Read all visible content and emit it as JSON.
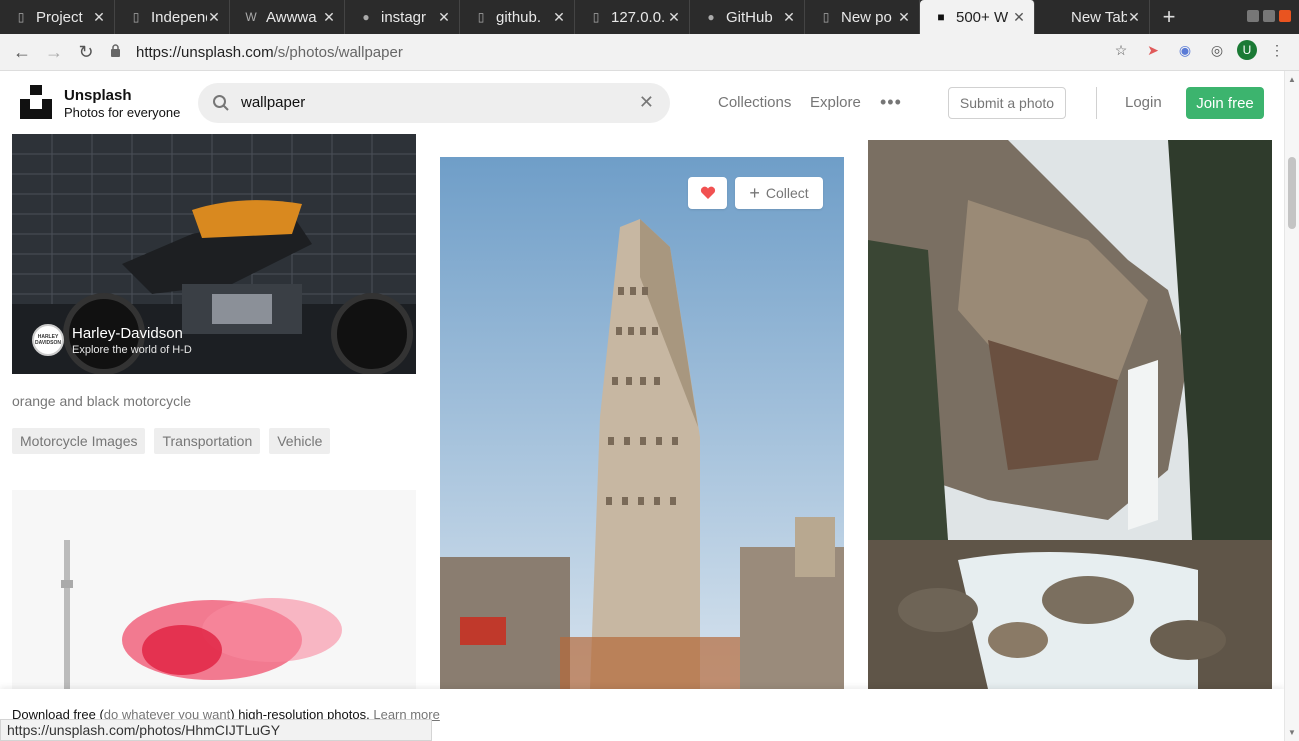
{
  "browser": {
    "tabs": [
      {
        "title": "Project",
        "icon": "page-icon"
      },
      {
        "title": "Independ",
        "icon": "page-icon"
      },
      {
        "title": "Awwwa",
        "icon": "awwwards-icon"
      },
      {
        "title": "instagr",
        "icon": "github-icon"
      },
      {
        "title": "github.",
        "icon": "page-icon"
      },
      {
        "title": "127.0.0.",
        "icon": "page-icon"
      },
      {
        "title": "GitHub",
        "icon": "github-icon"
      },
      {
        "title": "New po",
        "icon": "page-icon"
      },
      {
        "title": "500+ W",
        "icon": "unsplash-icon",
        "active": true
      },
      {
        "title": "New Tab",
        "icon": "none"
      }
    ],
    "url_host": "https://unsplash.com",
    "url_path": "/s/photos/wallpaper",
    "profile_initial": "U",
    "status_url": "https://unsplash.com/photos/HhmCIJTLuGY"
  },
  "header": {
    "brand_name": "Unsplash",
    "brand_tagline": "Photos for everyone",
    "search_value": "wallpaper",
    "nav": {
      "collections": "Collections",
      "explore": "Explore",
      "more": "•••"
    },
    "submit_label": "Submit a photo",
    "login_label": "Login",
    "join_label": "Join free",
    "accent_color": "#3cb46e"
  },
  "photos": {
    "sponsor_name": "Harley-Davidson",
    "sponsor_subtitle": "Explore the world of H-D",
    "sponsor_avatar_text": "HARLEY DAVIDSON",
    "caption": "orange and black motorcycle",
    "tags": [
      "Motorcycle Images",
      "Transportation",
      "Vehicle"
    ],
    "collect_label": "Collect"
  },
  "banner": {
    "lead": "Download free (",
    "soft": "do whatever you want",
    "tail": ") high-resolution photos.",
    "link": "Learn more"
  }
}
